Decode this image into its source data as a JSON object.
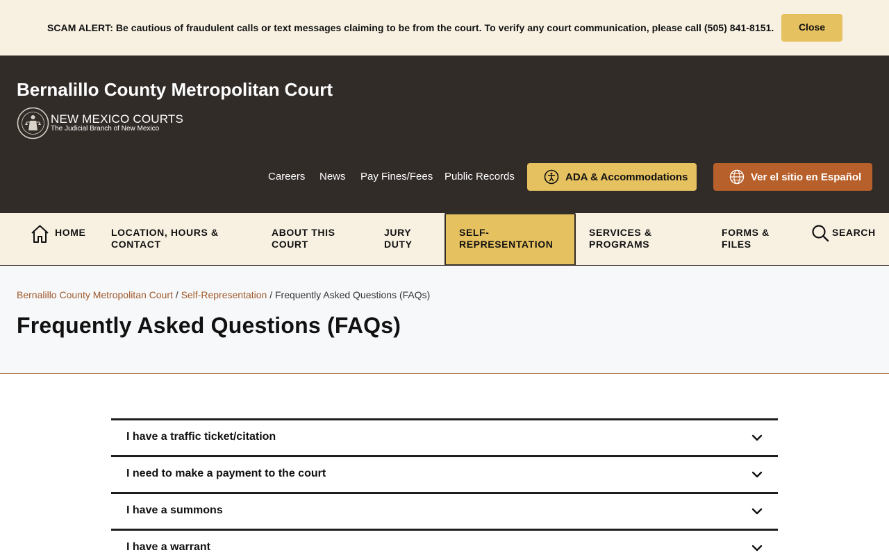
{
  "alert": {
    "text": "SCAM ALERT: Be cautious of fraudulent calls or text messages claiming to be from the court. To verify any court communication, please call (505) 841-8151.",
    "close_label": "Close"
  },
  "header": {
    "site_title": "Bernalillo County Metropolitan Court",
    "logo_main": "NEW MEXICO COURTS",
    "logo_sub": "The Judicial Branch of New Mexico",
    "utility_links": [
      "Careers",
      "News",
      "Pay Fines/Fees",
      "Public Records"
    ],
    "ada_label": "ADA & Accommodations",
    "espanol_label": "Ver el sitio en Español"
  },
  "nav": {
    "home": "HOME",
    "location": [
      "LOCATION, HOURS &",
      "CONTACT"
    ],
    "about": [
      "ABOUT THIS",
      "COURT"
    ],
    "jury": [
      "JURY",
      "DUTY"
    ],
    "self_rep": [
      "SELF-",
      "REPRESENTATION"
    ],
    "services": [
      "SERVICES &",
      "PROGRAMS"
    ],
    "forms": [
      "FORMS &",
      "FILES"
    ],
    "search": "SEARCH"
  },
  "breadcrumb": {
    "items": [
      "Bernalillo County Metropolitan Court",
      "Self-Representation"
    ],
    "current": "Frequently Asked Questions (FAQs)",
    "separator": "/"
  },
  "page_title": "Frequently Asked Questions (FAQs)",
  "faqs": [
    "I have a traffic ticket/citation",
    "I need to make a payment to the court",
    "I have a summons",
    "I have a warrant"
  ],
  "colors": {
    "header_bg": "#322c29",
    "cream": "#f8f1e2",
    "gold": "#e6c15f",
    "rust": "#b8602b",
    "link": "#a05a2a"
  }
}
